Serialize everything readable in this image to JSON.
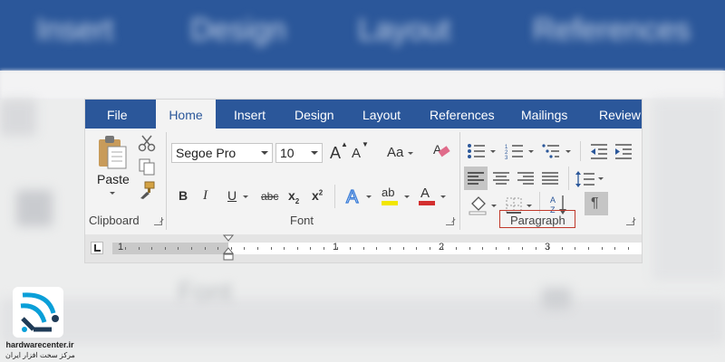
{
  "background": {
    "tabs": [
      "Insert",
      "Design",
      "Layout",
      "References"
    ],
    "font_label": "Font"
  },
  "tabs": [
    {
      "label": "File",
      "active": false
    },
    {
      "label": "Home",
      "active": true
    },
    {
      "label": "Insert",
      "active": false
    },
    {
      "label": "Design",
      "active": false
    },
    {
      "label": "Layout",
      "active": false
    },
    {
      "label": "References",
      "active": false
    },
    {
      "label": "Mailings",
      "active": false
    },
    {
      "label": "Review",
      "active": false
    }
  ],
  "clipboard": {
    "paste_label": "Paste",
    "group_label": "Clipboard",
    "icons": [
      "paste-icon",
      "cut-icon",
      "copy-icon",
      "format-painter-icon"
    ]
  },
  "font": {
    "family": "Segoe Pro",
    "size": "10",
    "case_label": "Aa",
    "group_label": "Font",
    "bold": "B",
    "italic": "I",
    "underline": "U",
    "strike": "abc",
    "highlight_color": "#f2e600",
    "font_color": "#d32f2f",
    "letter_a": "A",
    "letter_ab": "ab"
  },
  "paragraph": {
    "group_label": "Paragraph",
    "highlight_color": "#c0392b"
  },
  "ruler": {
    "numbers": [
      "1",
      "1",
      "2",
      "3"
    ]
  },
  "logo": {
    "site": "hardwarecenter.ir",
    "tagline": "مرکز سخت افزار ایران",
    "brand_color": "#0a9fd8"
  },
  "colors": {
    "ribbon_blue": "#2b579a",
    "ribbon_bg": "#f3f3f3"
  }
}
